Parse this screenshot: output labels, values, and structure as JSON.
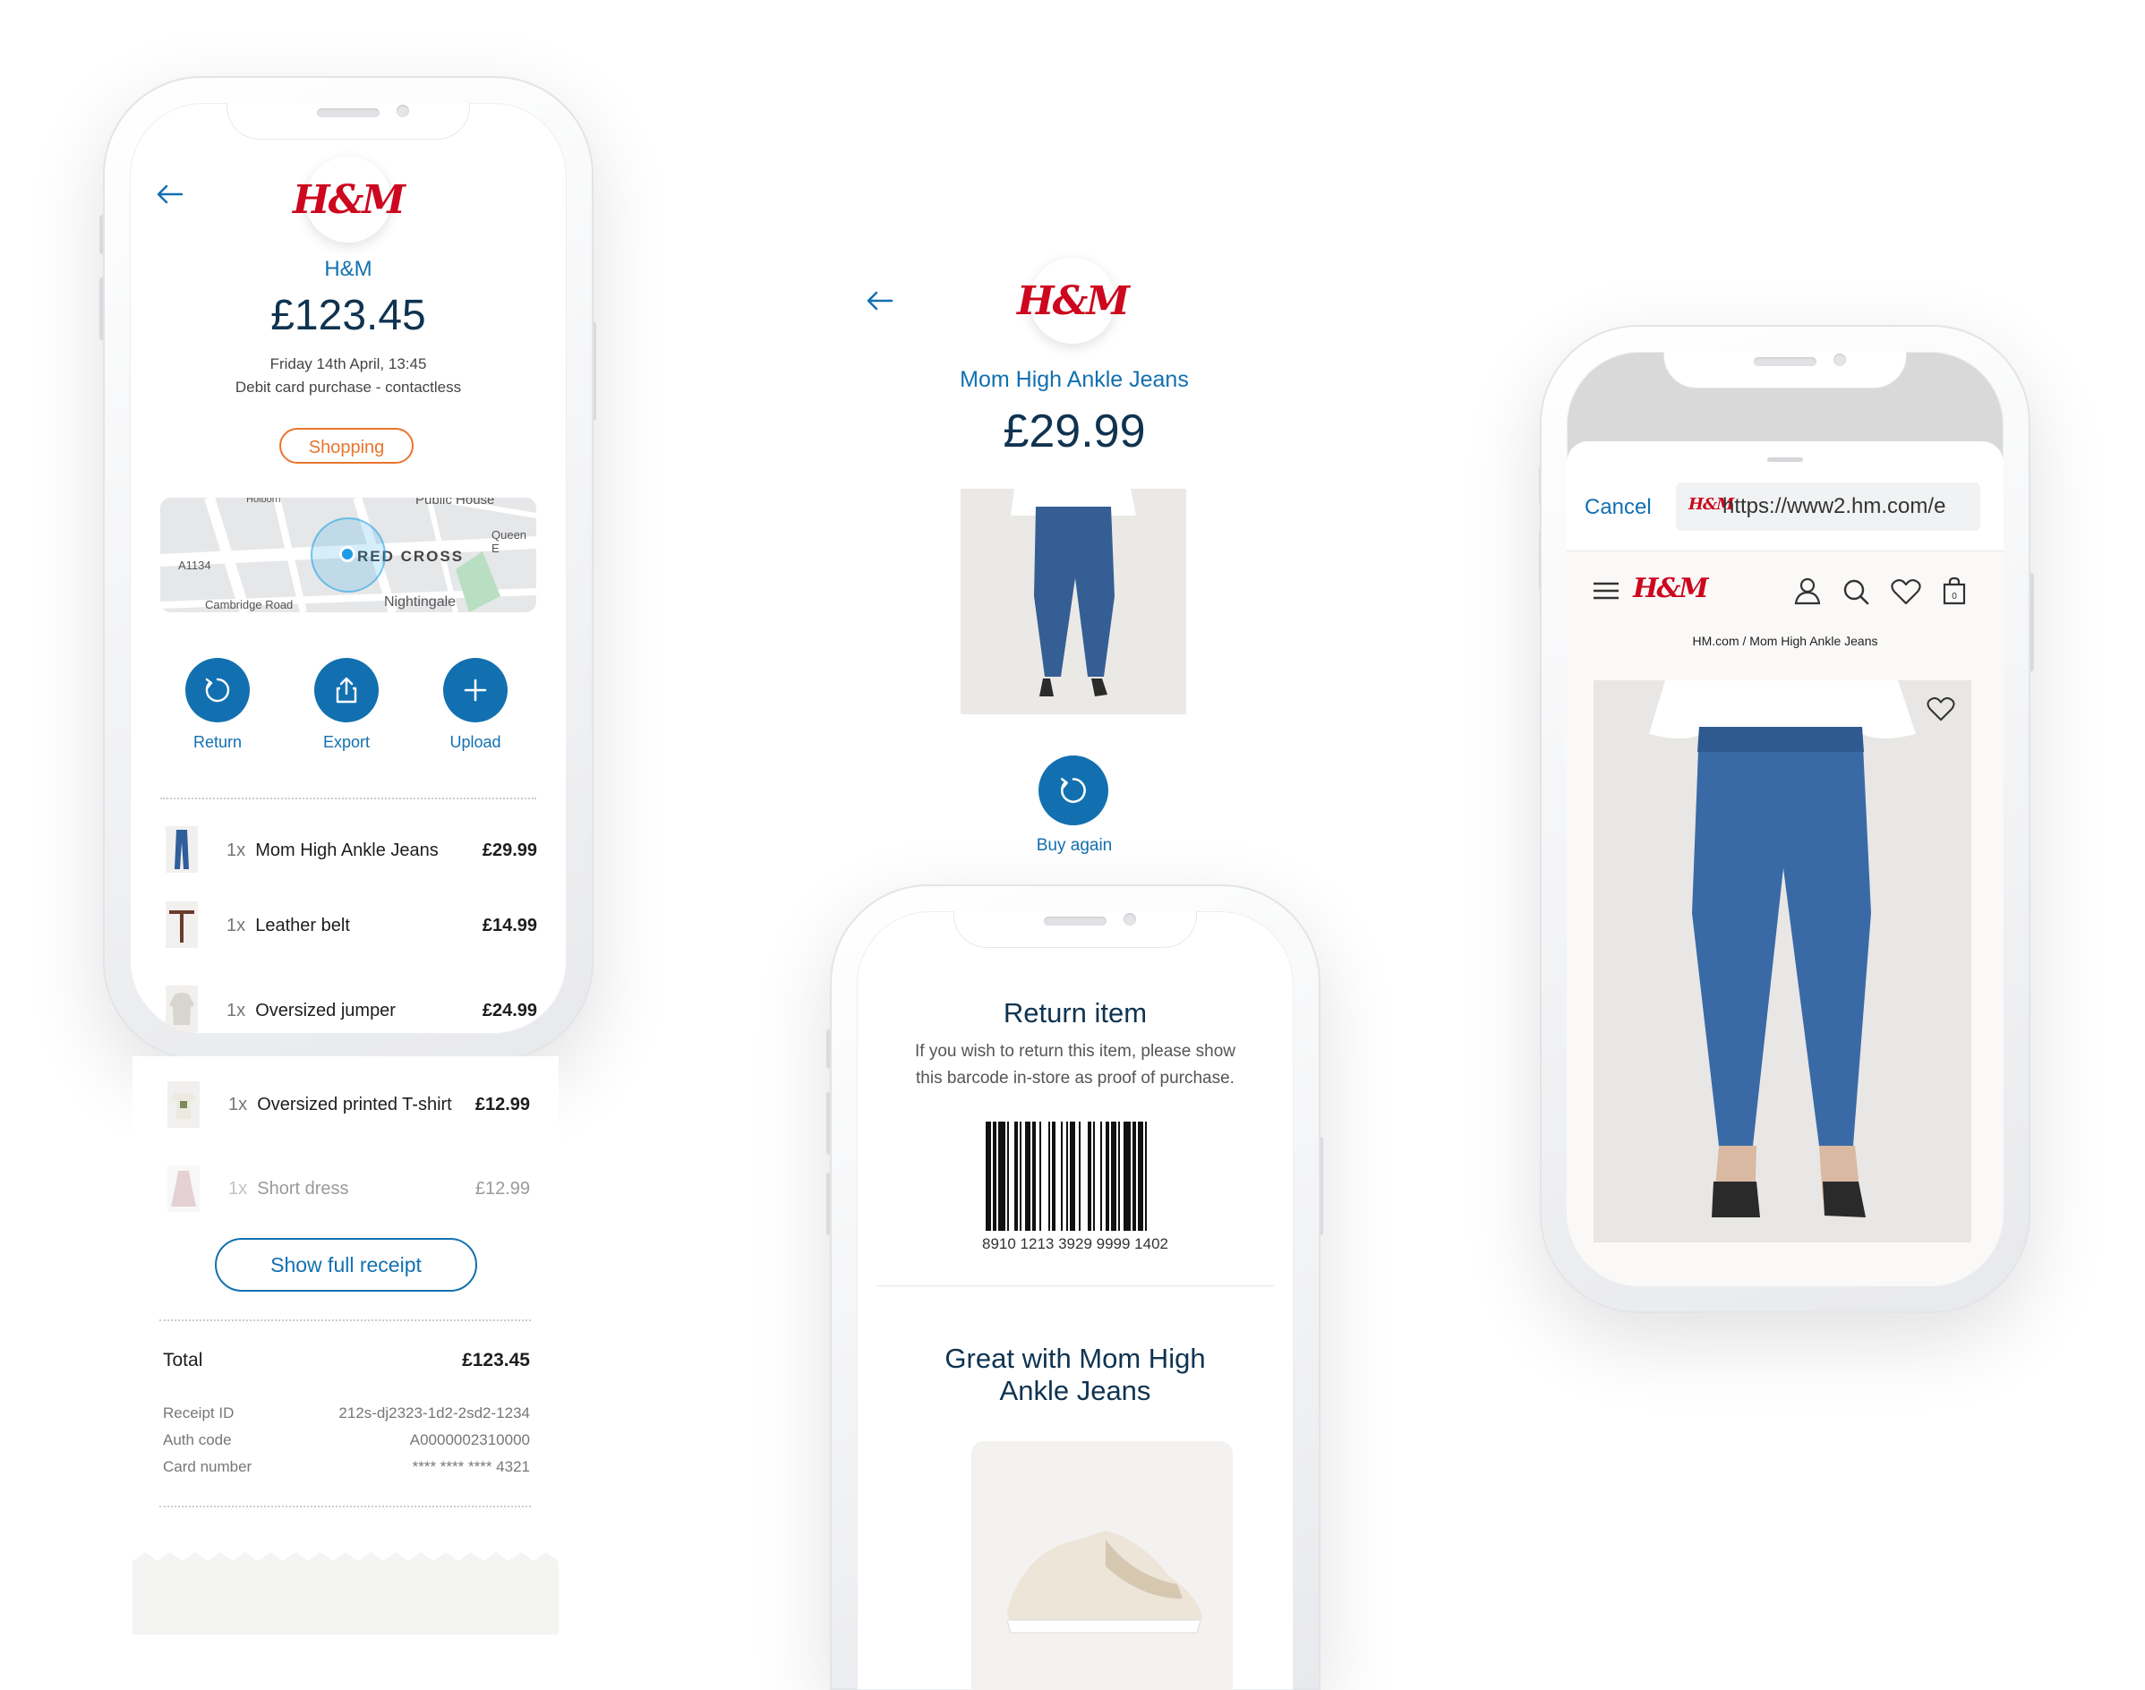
{
  "left_phone": {
    "merchant": "H&M",
    "amount": "£123.45",
    "datetime": "Friday 14th April, 13:45",
    "payment_type": "Debit card purchase - contactless",
    "category_tag": "Shopping",
    "map_labels": {
      "holborn": "Holborn",
      "public_house": "Public House",
      "queen": "Queen E",
      "a1134": "A1134",
      "red_cross": "RED CROSS",
      "cambridge": "Cambridge Road",
      "nightingale": "Nightingale"
    },
    "actions": [
      {
        "label": "Return"
      },
      {
        "label": "Export"
      },
      {
        "label": "Upload"
      }
    ],
    "items": [
      {
        "qty": "1x",
        "name": "Mom High Ankle Jeans",
        "price": "£29.99"
      },
      {
        "qty": "1x",
        "name": "Leather belt",
        "price": "£14.99"
      },
      {
        "qty": "1x",
        "name": "Oversized jumper",
        "price": "£24.99"
      },
      {
        "qty": "1x",
        "name": "Oversized printed T-shirt",
        "price": "£12.99"
      },
      {
        "qty": "1x",
        "name": "Short dress",
        "price": "£12.99"
      }
    ],
    "show_receipt": "Show full receipt",
    "total_label": "Total",
    "total_value": "£123.45",
    "meta": [
      {
        "label": "Receipt ID",
        "value": "212s-dj2323-1d2-2sd2-1234"
      },
      {
        "label": "Auth code",
        "value": "A0000002310000"
      },
      {
        "label": "Card number",
        "value": "**** **** **** 4321"
      }
    ]
  },
  "middle": {
    "product_name": "Mom High Ankle Jeans",
    "product_price": "£29.99",
    "buy_again": "Buy again",
    "return_title": "Return item",
    "return_desc_1": "If you wish to return this item, please show",
    "return_desc_2": "this barcode in-store as proof of purchase.",
    "barcode_number": "8910 1213 3929 9999 1402",
    "great_with": "Great with Mom High Ankle Jeans"
  },
  "right_phone": {
    "cancel": "Cancel",
    "url": "https://www2.hm.com/e",
    "breadcrumb": "HM.com / Mom High Ankle Jeans",
    "logo": "H&M"
  },
  "colors": {
    "brand_blue": "#1270b0",
    "navy": "#0f3350",
    "hm_red": "#cc071e",
    "shopping_orange": "#e8762e"
  }
}
